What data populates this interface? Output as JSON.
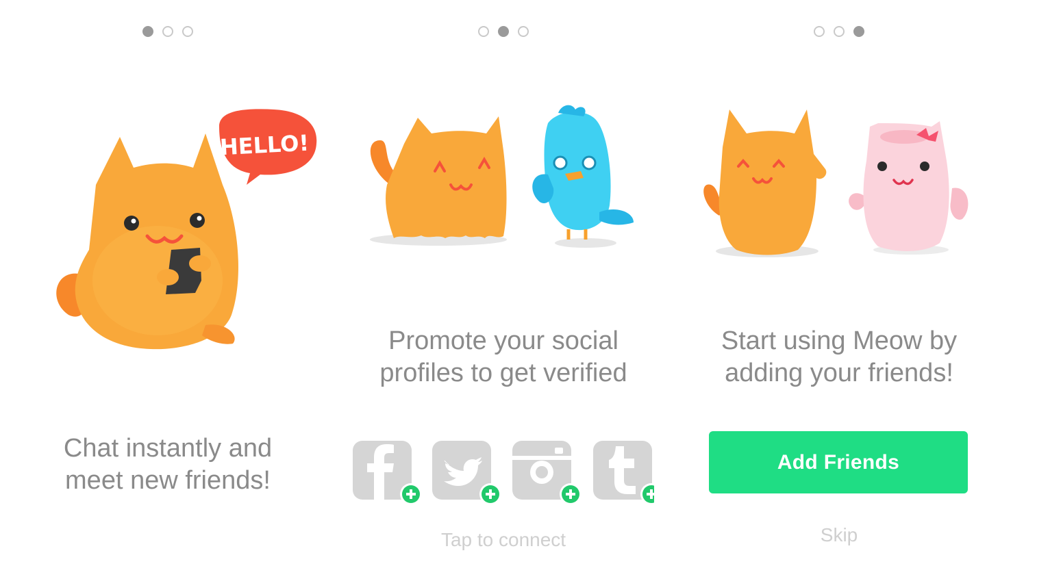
{
  "onboarding": {
    "screens": [
      {
        "caption": "Chat instantly and\nmeet new friends!",
        "bubble_text": "HELLO!"
      },
      {
        "caption": "Promote your social\nprofiles to get verified",
        "hint": "Tap to connect"
      },
      {
        "caption": "Start using Meow by\nadding your friends!",
        "button_label": "Add Friends",
        "skip_label": "Skip"
      }
    ]
  },
  "colors": {
    "accent_green": "#1fdd84",
    "cat_orange": "#f9a83a",
    "bird_blue": "#3fd0f2",
    "kitty_pink": "#fbd3dc",
    "speech_red": "#f5523a"
  }
}
